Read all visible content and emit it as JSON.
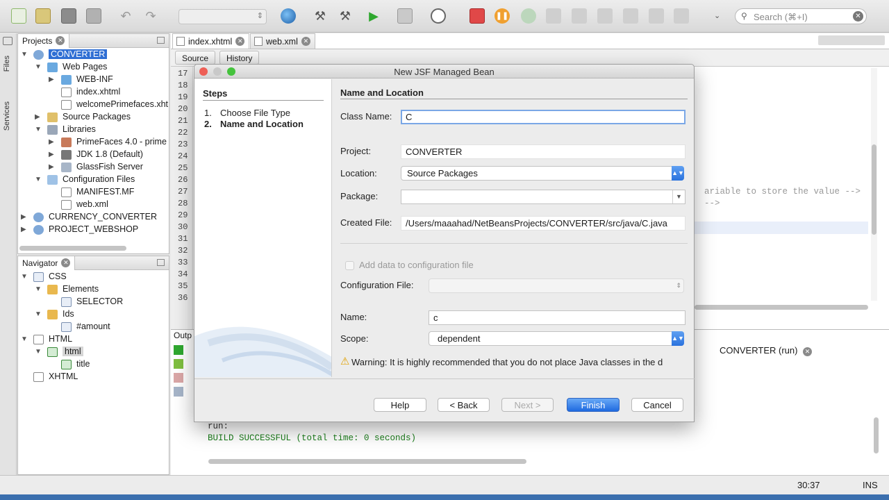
{
  "toolbar": {
    "search_placeholder": "Search (⌘+I)",
    "icons": [
      "new-file-icon",
      "new-project-icon",
      "open-project-icon",
      "close-project-icon",
      "undo-icon",
      "redo-icon",
      "globe-icon",
      "build-icon",
      "clean-build-icon",
      "run-icon",
      "debug-icon",
      "profile-icon",
      "stop-icon",
      "pause-icon",
      "continue-icon",
      "step-over-icon",
      "step-into-icon",
      "step-out-icon",
      "run-to-cursor-icon",
      "apply-changes-icon",
      "more-icon"
    ]
  },
  "side_strip": {
    "files": "Files",
    "services": "Services"
  },
  "projects": {
    "tab": "Projects",
    "items": [
      {
        "label": "CONVERTER"
      },
      {
        "label": "Web Pages"
      },
      {
        "label": "WEB-INF"
      },
      {
        "label": "index.xhtml"
      },
      {
        "label": "welcomePrimefaces.xht"
      },
      {
        "label": "Source Packages"
      },
      {
        "label": "Libraries"
      },
      {
        "label": "PrimeFaces 4.0 - prime"
      },
      {
        "label": "JDK 1.8 (Default)"
      },
      {
        "label": "GlassFish Server"
      },
      {
        "label": "Configuration Files"
      },
      {
        "label": "MANIFEST.MF"
      },
      {
        "label": "web.xml"
      },
      {
        "label": "CURRENCY_CONVERTER"
      },
      {
        "label": "PROJECT_WEBSHOP"
      }
    ]
  },
  "navigator": {
    "tab": "Navigator",
    "items": [
      {
        "label": "CSS"
      },
      {
        "label": "Elements"
      },
      {
        "label": "SELECTOR"
      },
      {
        "label": "Ids"
      },
      {
        "label": "#amount"
      },
      {
        "label": "HTML"
      },
      {
        "label": "html"
      },
      {
        "label": "title"
      },
      {
        "label": "XHTML"
      }
    ]
  },
  "editor": {
    "tabs": [
      {
        "label": "index.xhtml"
      },
      {
        "label": "web.xml"
      }
    ],
    "source_label": "Source",
    "history_label": "History",
    "line_numbers": [
      "17",
      "18",
      "19",
      "20",
      "21",
      "22",
      "23",
      "24",
      "25",
      "26",
      "27",
      "28",
      "29",
      "30",
      "31",
      "32",
      "33",
      "34",
      "35",
      "36"
    ],
    "code_line_1": "ariable to store the value -->",
    "code_line_2": "-->"
  },
  "output": {
    "tab_label": "Outp",
    "run_tab": "CONVERTER (run)",
    "line_run": "run:",
    "line_build": "BUILD SUCCESSFUL (total time: 0 seconds)"
  },
  "status": {
    "position": "30:37",
    "mode": "INS"
  },
  "dialog": {
    "title": "New JSF Managed Bean",
    "steps_title": "Steps",
    "steps": [
      {
        "num": "1.",
        "label": "Choose File Type"
      },
      {
        "num": "2.",
        "label": "Name and Location"
      }
    ],
    "section_title": "Name and Location",
    "class_name_label": "Class Name:",
    "class_name_value": "C",
    "project_label": "Project:",
    "project_value": "CONVERTER",
    "location_label": "Location:",
    "location_value": "Source Packages",
    "package_label": "Package:",
    "package_value": "",
    "created_file_label": "Created File:",
    "created_file_value": "/Users/maaahad/NetBeansProjects/CONVERTER/src/java/C.java",
    "add_config_label": "Add data to configuration file",
    "config_file_label": "Configuration File:",
    "config_file_value": "",
    "name_label": "Name:",
    "name_value": "c",
    "scope_label": "Scope:",
    "scope_value": "dependent",
    "warning": "Warning: It is highly recommended that you do not place Java classes in the d",
    "buttons": {
      "help": "Help",
      "back": "< Back",
      "next": "Next >",
      "finish": "Finish",
      "cancel": "Cancel"
    }
  }
}
